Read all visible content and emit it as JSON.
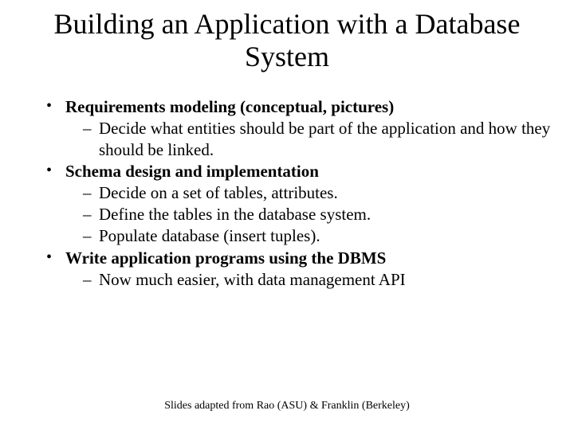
{
  "title": "Building an Application with a Database System",
  "bullets": [
    {
      "label": "Requirements modeling (conceptual, pictures)",
      "subs": [
        "Decide what entities should be part of the application and how they should be linked."
      ]
    },
    {
      "label": "Schema design and implementation",
      "subs": [
        "Decide on a set of tables, attributes.",
        "Define the tables in the database system.",
        "Populate database (insert tuples)."
      ]
    },
    {
      "label": "Write application programs using the DBMS",
      "subs": [
        "Now much easier, with data management API"
      ]
    }
  ],
  "footer": "Slides adapted from Rao (ASU) & Franklin (Berkeley)"
}
